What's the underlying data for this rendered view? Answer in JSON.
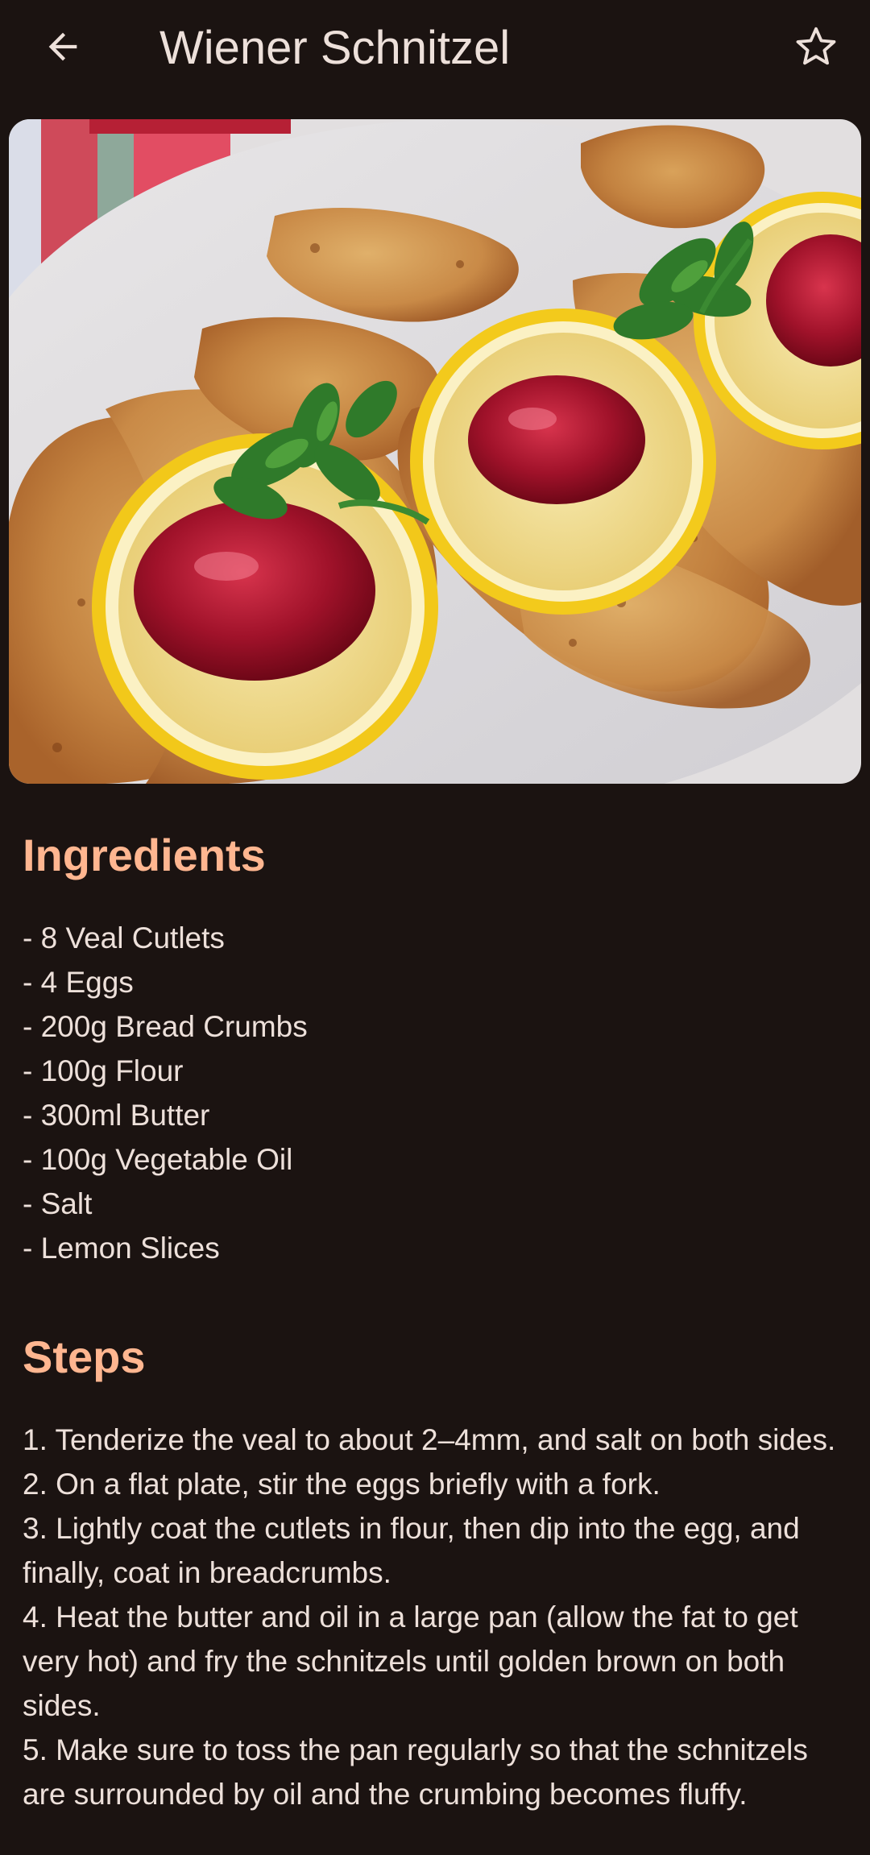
{
  "app_bar": {
    "title": "Wiener Schnitzel",
    "back_icon": "arrow-left-icon",
    "favorite_icon": "star-outline-icon"
  },
  "hero_image": {
    "subject": "breaded veal schnitzels with lemon slices, cranberry jam and parsley"
  },
  "ingredients": {
    "heading": "Ingredients",
    "items": [
      "- 8 Veal Cutlets",
      "- 4 Eggs",
      "- 200g Bread Crumbs",
      "- 100g Flour",
      "- 300ml Butter",
      "- 100g Vegetable Oil",
      "- Salt",
      "- Lemon Slices"
    ]
  },
  "steps": {
    "heading": "Steps",
    "items": [
      "1. Tenderize the veal to about 2–4mm, and salt on both sides.",
      "2. On a flat plate, stir the eggs briefly with a fork.",
      "3. Lightly coat the cutlets in flour, then dip into the egg, and finally, coat in breadcrumbs.",
      "4. Heat the butter and oil in a large pan (allow the fat to get very hot) and fry the schnitzels until golden brown on both sides.",
      "5. Make sure to toss the pan regularly so that the schnitzels are surrounded by oil and the crumbing becomes fluffy."
    ]
  },
  "colors": {
    "background": "#1b1311",
    "heading_accent": "#ffb690",
    "on_surface": "#ede0da"
  }
}
